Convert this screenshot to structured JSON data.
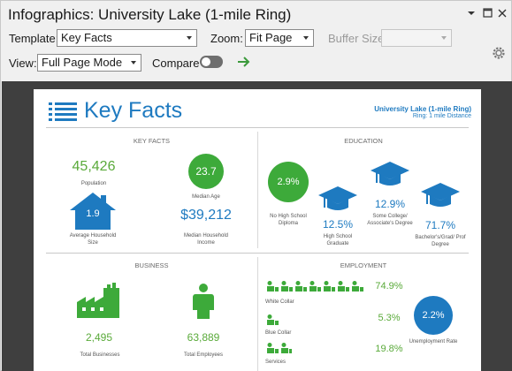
{
  "window": {
    "title": "Infographics: University Lake (1-mile Ring)",
    "controls": {
      "pin": "▾",
      "maximize": "□",
      "close": "✕"
    }
  },
  "toolbar": {
    "template_label": "Template:",
    "template_value": "Key Facts",
    "zoom_label": "Zoom:",
    "zoom_value": "Fit Page",
    "buffer_label": "Buffer Size:",
    "buffer_value": "",
    "view_label": "View:",
    "view_value": "Full Page Mode",
    "compare_label": "Compare"
  },
  "colors": {
    "accent_blue": "#1e7ac0",
    "accent_green": "#5aaa3a",
    "canvas": "#3f3f3f"
  },
  "report": {
    "title": "Key Facts",
    "location_name": "University Lake (1-mile Ring)",
    "location_ring": "Ring: 1 mile Distance",
    "key_facts": {
      "heading": "KEY FACTS",
      "population_value": "45,426",
      "population_label": "Population",
      "median_age_value": "23.7",
      "median_age_label": "Median Age",
      "household_size_value": "1.9",
      "household_size_label": "Average Household Size",
      "household_income_value": "$39,212",
      "household_income_label": "Median Household Income"
    },
    "education": {
      "heading": "EDUCATION",
      "no_hs_value": "2.9%",
      "no_hs_label": "No High School Diploma",
      "hs_value": "12.5%",
      "hs_label": "High School Graduate",
      "some_college_value": "12.9%",
      "some_college_label": "Some College/ Associate's Degree",
      "bachelors_value": "71.7%",
      "bachelors_label": "Bachelor's/Grad/ Prof Degree"
    },
    "business": {
      "heading": "BUSINESS",
      "total_businesses_value": "2,495",
      "total_businesses_label": "Total Businesses",
      "total_employees_value": "63,889",
      "total_employees_label": "Total Employees"
    },
    "employment": {
      "heading": "EMPLOYMENT",
      "white_collar_value": "74.9%",
      "white_collar_label": "White Collar",
      "blue_collar_value": "5.3%",
      "blue_collar_label": "Blue Collar",
      "services_value": "19.8%",
      "services_label": "Services",
      "unemployment_value": "2.2%",
      "unemployment_label": "Unemployment Rate"
    }
  }
}
